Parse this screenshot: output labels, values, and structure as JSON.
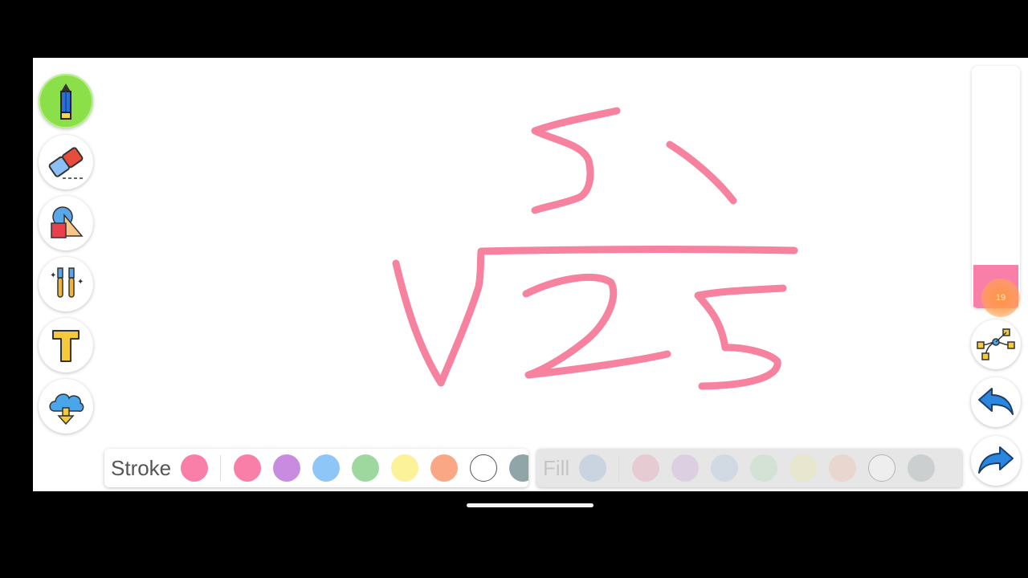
{
  "app": {
    "background": "#000000",
    "canvas_color": "#ffffff",
    "ink_color": "#f6829f"
  },
  "toolbar": {
    "tools": [
      {
        "name": "pencil",
        "icon": "pencil-icon",
        "active": true
      },
      {
        "name": "eraser",
        "icon": "eraser-icon",
        "active": false
      },
      {
        "name": "shapes",
        "icon": "shapes-icon",
        "active": false
      },
      {
        "name": "brushes",
        "icon": "brushes-icon",
        "active": false
      },
      {
        "name": "text",
        "icon": "text-icon",
        "active": false
      },
      {
        "name": "download",
        "icon": "cloud-download-icon",
        "active": false
      }
    ]
  },
  "stroke_palette": {
    "label": "Stroke",
    "current_color": "#f97fa8",
    "colors": [
      "#f97fa8",
      "#c98be0",
      "#8ec7f7",
      "#9ed89f",
      "#fbf29a",
      "#f9a785",
      "#ffffff",
      "#8fa5a8"
    ]
  },
  "fill_palette": {
    "label": "Fill",
    "current_color": "#93b3d3",
    "colors": [
      "#e997b0",
      "#c9a4d8",
      "#a8c0dc",
      "#b3d6b4",
      "#efe6a2",
      "#eab7a4",
      "#ffffff",
      "#9aa3a6"
    ]
  },
  "right_controls": {
    "size_slider": {
      "level": 0.18,
      "fill_color": "#f97fa8",
      "knob_value": "19"
    },
    "buttons": [
      {
        "name": "path",
        "icon": "bezier-path-icon"
      },
      {
        "name": "undo",
        "icon": "undo-icon"
      },
      {
        "name": "redo",
        "icon": "redo-icon"
      }
    ]
  }
}
